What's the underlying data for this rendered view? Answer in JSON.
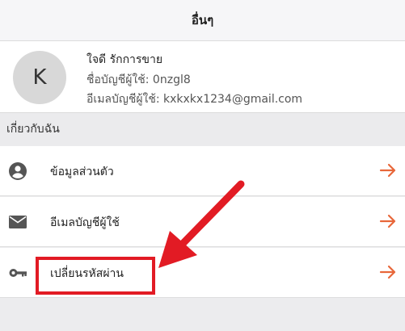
{
  "header": {
    "title": "อื่นๆ"
  },
  "profile": {
    "avatar_letter": "K",
    "name": "ใจดี รักการขาย",
    "username": "ชื่อบัญชีผู้ใช้: 0nzgl8",
    "email": "อีเมลบัญชีผู้ใช้: kxkxkx1234@gmail.com"
  },
  "section": {
    "title": "เกี่ยวกับฉัน"
  },
  "menu": [
    {
      "label": "ข้อมูลส่วนตัว",
      "icon": "person-icon"
    },
    {
      "label": "อีเมลบัญชีผู้ใช้",
      "icon": "mail-icon"
    },
    {
      "label": "เปลี่ยนรหัสผ่าน",
      "icon": "key-icon"
    }
  ],
  "colors": {
    "accent": "#e8673a",
    "annotation": "#e21b24"
  }
}
